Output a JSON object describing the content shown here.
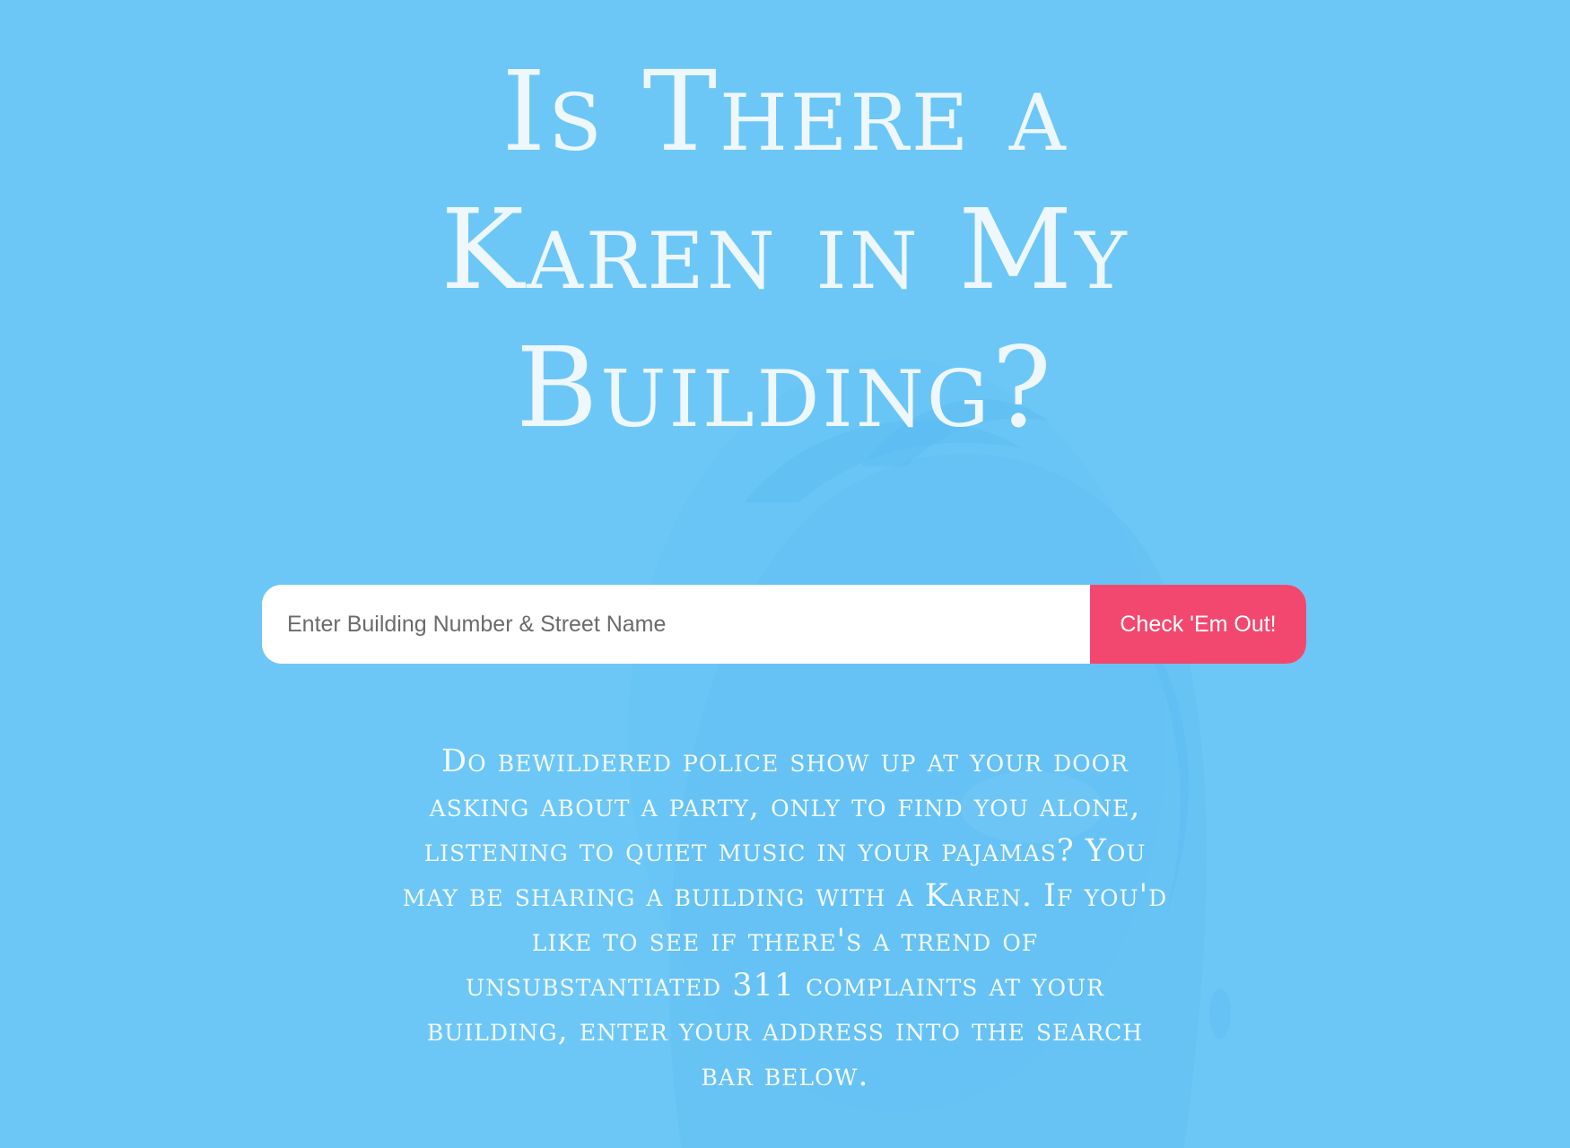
{
  "hero": {
    "title": "Is There a Karen in My Building?"
  },
  "search": {
    "placeholder": "Enter Building Number & Street Name",
    "value": "",
    "button_label": "Check 'Em Out!"
  },
  "intro": {
    "text": "Do bewildered police show up at your door asking about a party, only to find you alone, listening to quiet music in your pajamas? You may be sharing a building with a Karen. If you'd like to see if there's a trend of unsubstantiated 311 complaints at your building, enter your address into the search bar below."
  },
  "colors": {
    "background": "#6dc7f6",
    "title_text": "#eef7fb",
    "button": "#f2486f",
    "input_background": "#ffffff"
  }
}
